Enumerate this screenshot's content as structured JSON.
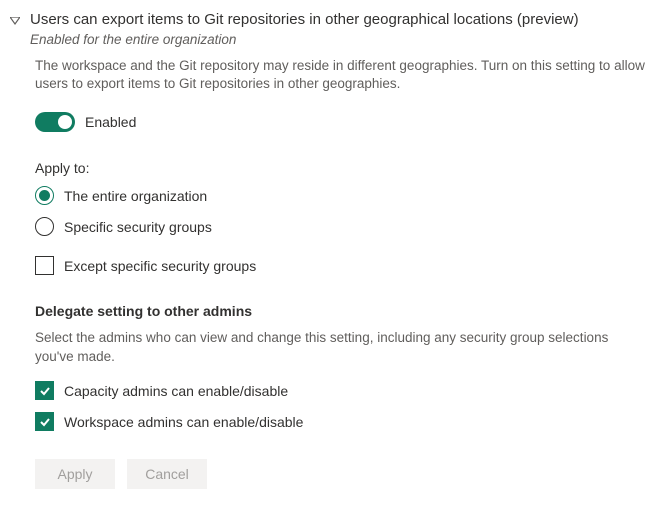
{
  "title": "Users can export items to Git repositories in other geographical locations (preview)",
  "subtitle": "Enabled for the entire organization",
  "description": "The workspace and the Git repository may reside in different geographies. Turn on this setting to allow users to export items to Git repositories in other geographies.",
  "toggle": {
    "label": "Enabled",
    "state": "on"
  },
  "applyTo": {
    "label": "Apply to:",
    "option1": "The entire organization",
    "option2": "Specific security groups",
    "except": "Except specific security groups"
  },
  "delegate": {
    "heading": "Delegate setting to other admins",
    "description": "Select the admins who can view and change this setting, including any security group selections you've made.",
    "option1": "Capacity admins can enable/disable",
    "option2": "Workspace admins can enable/disable"
  },
  "buttons": {
    "apply": "Apply",
    "cancel": "Cancel"
  }
}
